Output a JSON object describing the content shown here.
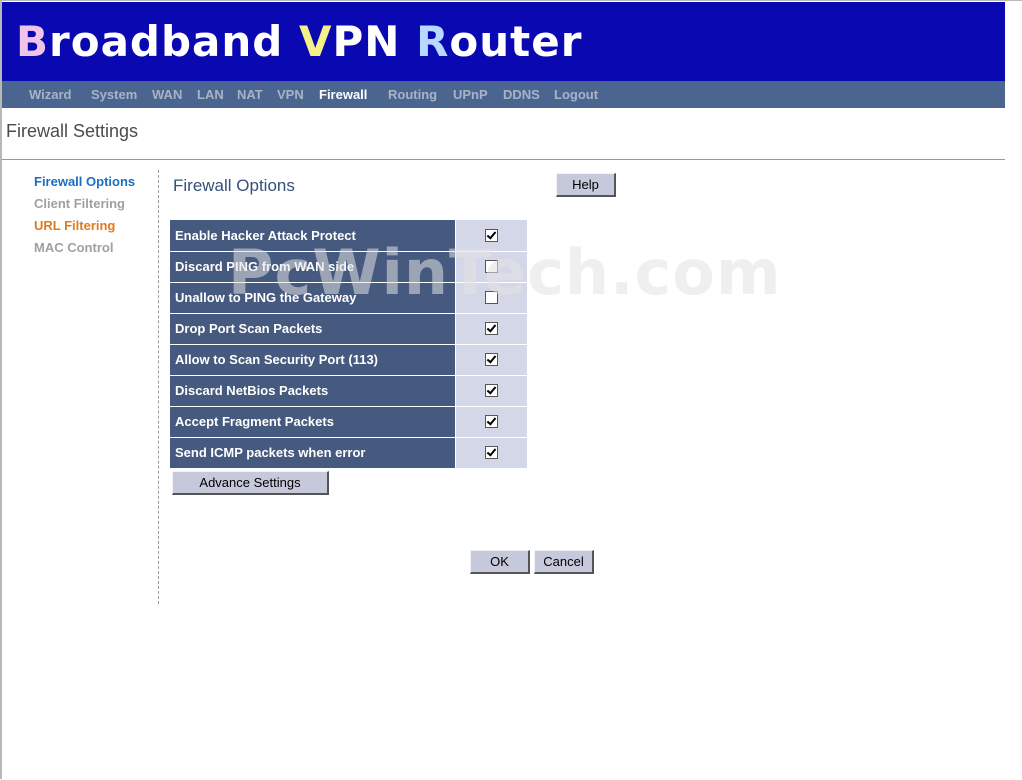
{
  "banner": {
    "cap_b": "B",
    "rest_b": "roadband ",
    "cap_v": "V",
    "rest_v": "PN ",
    "cap_r": "R",
    "rest_r": "outer"
  },
  "nav": [
    {
      "label": "Wizard"
    },
    {
      "label": "System"
    },
    {
      "label": "WAN"
    },
    {
      "label": "LAN"
    },
    {
      "label": "NAT"
    },
    {
      "label": "VPN"
    },
    {
      "label": "Firewall"
    },
    {
      "label": "Routing"
    },
    {
      "label": "UPnP"
    },
    {
      "label": "DDNS"
    },
    {
      "label": "Logout"
    }
  ],
  "nav_active": "Firewall",
  "page_title": "Firewall Settings",
  "sidebar": [
    {
      "label": "Firewall Options",
      "state": "active"
    },
    {
      "label": "Client Filtering",
      "state": "normal"
    },
    {
      "label": "URL Filtering",
      "state": "highlight"
    },
    {
      "label": "MAC Control",
      "state": "normal"
    }
  ],
  "section_title": "Firewall Options",
  "help_label": "Help",
  "options": [
    {
      "label": "Enable Hacker Attack Protect",
      "checked": true
    },
    {
      "label": "Discard PING from WAN side",
      "checked": false
    },
    {
      "label": "Unallow to PING the Gateway",
      "checked": false
    },
    {
      "label": "Drop Port Scan Packets",
      "checked": true
    },
    {
      "label": "Allow to Scan Security Port (113)",
      "checked": true
    },
    {
      "label": "Discard NetBios Packets",
      "checked": true
    },
    {
      "label": "Accept Fragment Packets",
      "checked": true
    },
    {
      "label": "Send ICMP packets when error",
      "checked": true
    }
  ],
  "advance_label": "Advance Settings",
  "ok_label": "OK",
  "cancel_label": "Cancel",
  "watermark": "PcWinTech.com",
  "colors": {
    "banner": "#0a08b0",
    "navbar": "#4a6690",
    "option_label_bg": "#46597e",
    "option_check_bg": "#d4d7e8",
    "sidebar_active": "#1a6fc4",
    "sidebar_highlight": "#e07a20"
  }
}
